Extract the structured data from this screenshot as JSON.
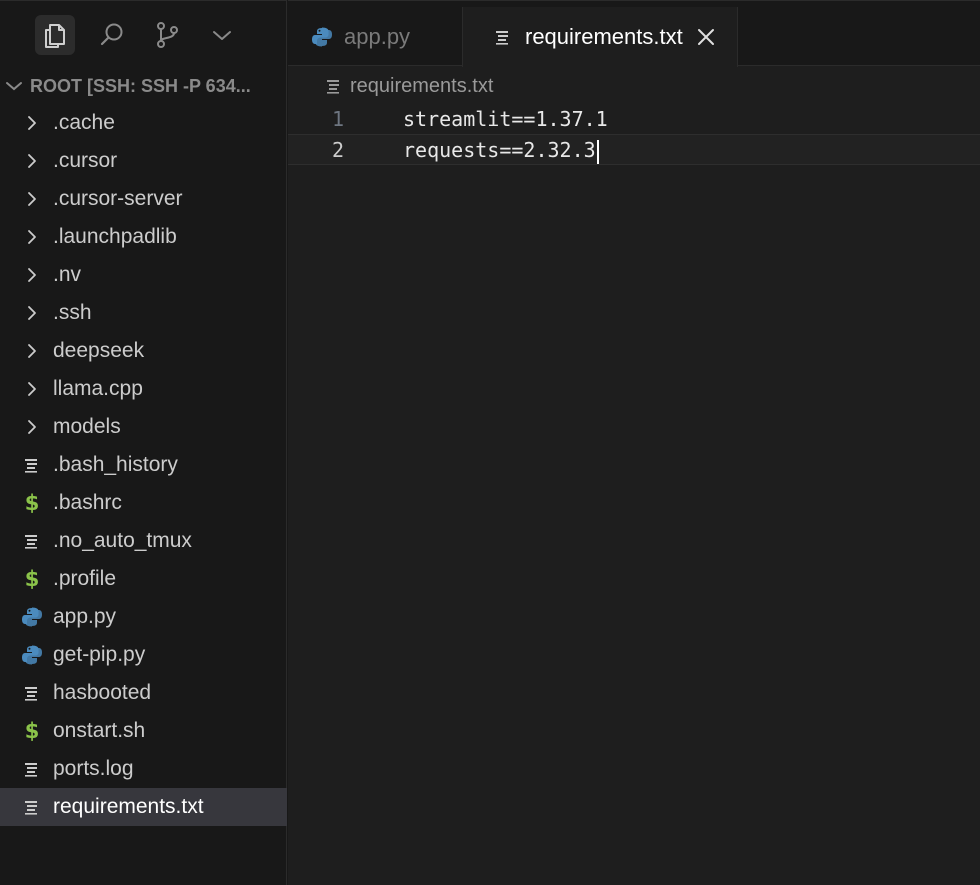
{
  "activity_bar": {
    "icons": [
      "files-icon",
      "search-icon",
      "source-control-icon",
      "chevron-down-icon"
    ]
  },
  "explorer": {
    "header": "ROOT [SSH: SSH -P 634...",
    "items": [
      {
        "label": ".cache",
        "kind": "folder"
      },
      {
        "label": ".cursor",
        "kind": "folder"
      },
      {
        "label": ".cursor-server",
        "kind": "folder"
      },
      {
        "label": ".launchpadlib",
        "kind": "folder"
      },
      {
        "label": ".nv",
        "kind": "folder"
      },
      {
        "label": ".ssh",
        "kind": "folder"
      },
      {
        "label": "deepseek",
        "kind": "folder"
      },
      {
        "label": "llama.cpp",
        "kind": "folder"
      },
      {
        "label": "models",
        "kind": "folder"
      },
      {
        "label": ".bash_history",
        "kind": "text"
      },
      {
        "label": ".bashrc",
        "kind": "shell"
      },
      {
        "label": ".no_auto_tmux",
        "kind": "text"
      },
      {
        "label": ".profile",
        "kind": "shell"
      },
      {
        "label": "app.py",
        "kind": "python"
      },
      {
        "label": "get-pip.py",
        "kind": "python"
      },
      {
        "label": "hasbooted",
        "kind": "text"
      },
      {
        "label": "onstart.sh",
        "kind": "shell"
      },
      {
        "label": "ports.log",
        "kind": "text"
      },
      {
        "label": "requirements.txt",
        "kind": "text",
        "selected": true
      }
    ],
    "dollar_glyph": "$"
  },
  "tabs": [
    {
      "label": "app.py",
      "active": false
    },
    {
      "label": "requirements.txt",
      "active": true
    }
  ],
  "breadcrumb": "requirements.txt",
  "editor": {
    "lines": [
      {
        "number": "1",
        "text": "streamlit==1.37.1"
      },
      {
        "number": "2",
        "text": "requests==2.32.3"
      }
    ]
  },
  "colors": {
    "background": "#181818",
    "editor_bg": "#1e1e1e",
    "selection": "#37373d",
    "python_blue": "#4b8bbe",
    "shell_green": "#8bc34a"
  }
}
